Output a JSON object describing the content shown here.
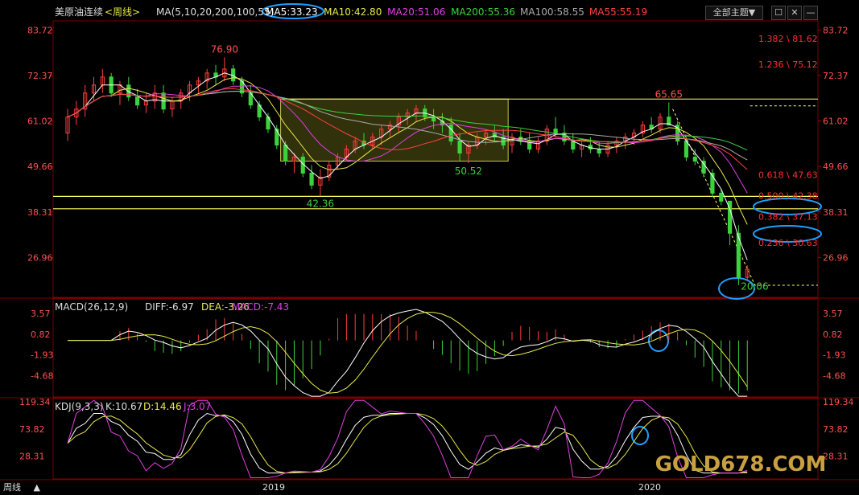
{
  "header": {
    "instrument": "美原油连续",
    "period_tag": "<周线>",
    "ma_label": "MA(5,10,20,200,100,55)",
    "ma_values": [
      {
        "text": "MA5:33.23",
        "color": "#ffffff"
      },
      {
        "text": "MA10:42.80",
        "color": "#e8e84a"
      },
      {
        "text": "MA20:51.06",
        "color": "#e040e0"
      },
      {
        "text": "MA200:55.36",
        "color": "#3cd23c"
      },
      {
        "text": "MA100:58.55",
        "color": "#aaaaaa"
      },
      {
        "text": "MA55:55.19",
        "color": "#ff4040"
      }
    ],
    "theme_button": "全部主题▼",
    "window_buttons": [
      "☐",
      "✕",
      "—"
    ]
  },
  "main_axis": {
    "left_ticks": [
      "83.72",
      "72.37",
      "61.02",
      "49.66",
      "38.31",
      "26.96"
    ],
    "right_ticks": [
      "83.72",
      "72.37",
      "61.02",
      "49.66",
      "38.31",
      "26.96"
    ]
  },
  "fib_levels": [
    {
      "text": "1.382 \\ 81.62",
      "color": "#ff3030"
    },
    {
      "text": "1.236 \\ 75.12",
      "color": "#ff3030"
    },
    {
      "text": "0.618 \\ 47.63",
      "color": "#ff3030"
    },
    {
      "text": "0.500 \\ 42.38",
      "color": "#ff3030"
    },
    {
      "text": "0.382 \\ 37.13",
      "color": "#ff3030"
    },
    {
      "text": "0.236 \\ 30.63",
      "color": "#ff3030"
    }
  ],
  "price_annotations": {
    "high_2018": "76.90",
    "low_2018": "42.36",
    "range_low": "50.52",
    "high_2020": "65.65",
    "low_2020": "20.06"
  },
  "macd_panel": {
    "label": "MACD(26,12,9)",
    "diff": "DIFF:-6.97",
    "dea": "DEA:-3.26",
    "macd": "MACD:-7.43",
    "ticks": [
      "3.57",
      "0.82",
      "-1.93",
      "-4.68"
    ]
  },
  "kdj_panel": {
    "label": "KDJ(9,3,3)",
    "k": "K:10.67",
    "d": "D:14.46",
    "j": "J:3.07",
    "ticks": [
      "119.34",
      "73.82",
      "28.31"
    ]
  },
  "x_axis": {
    "labels": [
      "2019",
      "2020"
    ]
  },
  "footer": {
    "period_button": "周线",
    "arrow": "▲"
  },
  "watermark": {
    "text": "GOLD678.COM"
  },
  "colors": {
    "up": "#ff3c3c",
    "down": "#3cd23c",
    "box_fill": "#5a5a14",
    "guide_yellow": "#ffff66"
  },
  "chart_data": {
    "type": "candlestick",
    "title": "美原油连续 <周线>",
    "ylim": [
      17,
      86
    ],
    "x_periods": 156,
    "x_start_label": "2017-07",
    "x_labels": {
      "2019": 58,
      "2020": 131
    },
    "candles": [
      [
        58,
        64,
        56,
        62
      ],
      [
        62,
        66,
        60,
        64
      ],
      [
        64,
        70,
        62,
        68
      ],
      [
        68,
        72,
        66,
        70
      ],
      [
        70,
        74,
        68,
        72
      ],
      [
        72,
        73,
        67,
        68
      ],
      [
        68,
        71,
        65,
        70
      ],
      [
        70,
        72,
        66,
        67
      ],
      [
        67,
        69,
        64,
        65
      ],
      [
        65,
        68,
        63,
        66
      ],
      [
        66,
        70,
        64,
        68
      ],
      [
        68,
        70,
        63,
        64
      ],
      [
        64,
        67,
        62,
        66
      ],
      [
        66,
        69,
        64,
        68
      ],
      [
        68,
        71,
        66,
        70
      ],
      [
        70,
        72,
        68,
        71
      ],
      [
        71,
        74,
        69,
        73
      ],
      [
        73,
        75,
        70,
        72
      ],
      [
        72,
        76.9,
        71,
        74
      ],
      [
        74,
        75,
        70,
        71
      ],
      [
        71,
        72,
        67,
        68
      ],
      [
        68,
        70,
        64,
        65
      ],
      [
        65,
        66,
        61,
        62
      ],
      [
        62,
        63,
        58,
        59
      ],
      [
        59,
        60,
        54,
        55
      ],
      [
        55,
        56,
        50,
        51
      ],
      [
        51,
        53,
        48,
        52
      ],
      [
        52,
        53,
        47,
        48
      ],
      [
        48,
        50,
        44,
        45
      ],
      [
        45,
        49,
        42.36,
        47
      ],
      [
        47,
        51,
        46,
        50
      ],
      [
        50,
        53,
        49,
        52
      ],
      [
        52,
        55,
        51,
        54
      ],
      [
        54,
        57,
        53,
        56
      ],
      [
        56,
        58,
        54,
        55
      ],
      [
        55,
        58,
        54,
        57
      ],
      [
        57,
        60,
        55,
        59
      ],
      [
        59,
        61,
        57,
        60
      ],
      [
        60,
        63,
        58,
        62
      ],
      [
        62,
        64,
        60,
        63
      ],
      [
        63,
        65,
        61,
        64
      ],
      [
        64,
        65,
        61,
        62
      ],
      [
        62,
        64,
        59,
        61
      ],
      [
        61,
        63,
        58,
        60
      ],
      [
        60,
        62,
        55,
        56
      ],
      [
        56,
        58,
        51,
        53
      ],
      [
        53,
        56,
        50.52,
        55
      ],
      [
        55,
        58,
        54,
        57
      ],
      [
        57,
        59,
        55,
        58
      ],
      [
        58,
        60,
        56,
        57
      ],
      [
        57,
        59,
        54,
        55
      ],
      [
        55,
        58,
        53,
        57
      ],
      [
        57,
        59,
        55,
        56
      ],
      [
        56,
        58,
        53,
        54
      ],
      [
        54,
        57,
        53,
        56
      ],
      [
        56,
        60,
        55,
        59
      ],
      [
        59,
        62,
        57,
        58
      ],
      [
        58,
        60,
        55,
        56
      ],
      [
        56,
        58,
        53,
        54
      ],
      [
        54,
        56,
        52,
        55
      ],
      [
        55,
        57,
        53,
        54
      ],
      [
        54,
        56,
        52,
        53
      ],
      [
        53,
        56,
        52,
        55
      ],
      [
        55,
        57,
        53,
        56
      ],
      [
        56,
        58,
        54,
        57
      ],
      [
        57,
        59,
        55,
        58
      ],
      [
        58,
        61,
        57,
        60
      ],
      [
        60,
        62,
        58,
        59
      ],
      [
        59,
        63,
        58,
        62
      ],
      [
        62,
        65.65,
        60,
        60
      ],
      [
        60,
        61,
        55,
        56
      ],
      [
        56,
        57,
        51,
        52
      ],
      [
        52,
        54,
        50,
        51
      ],
      [
        51,
        52,
        47,
        48
      ],
      [
        48,
        49,
        42,
        43
      ],
      [
        43,
        44,
        40,
        41
      ],
      [
        41,
        38,
        30,
        33
      ],
      [
        33,
        35,
        20.06,
        22
      ],
      [
        22,
        25,
        21,
        24
      ]
    ],
    "fibonacci": [
      [
        1.382,
        81.62
      ],
      [
        1.236,
        75.12
      ],
      [
        0.618,
        47.63
      ],
      [
        0.5,
        42.38
      ],
      [
        0.382,
        37.13
      ],
      [
        0.236,
        30.63
      ]
    ]
  }
}
